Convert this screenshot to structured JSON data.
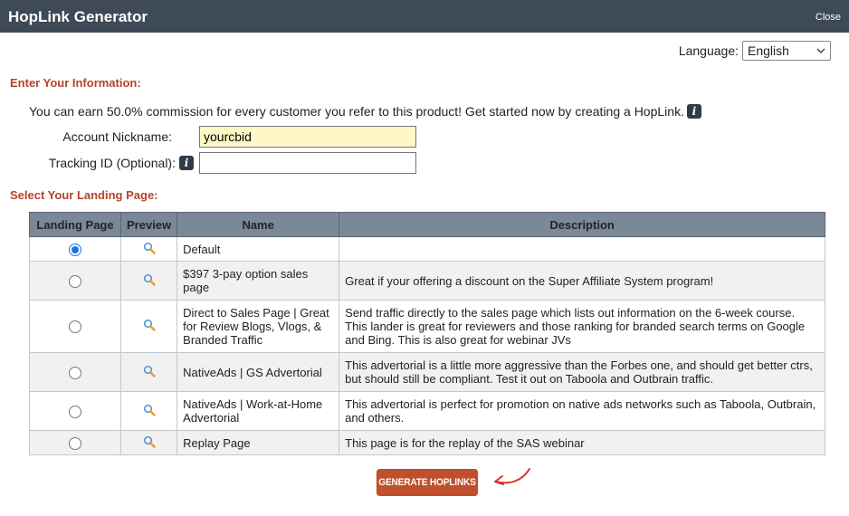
{
  "titlebar": {
    "title": "HopLink Generator",
    "close_label": "Close"
  },
  "language": {
    "label": "Language:",
    "selected": "English"
  },
  "section_info": "Enter Your Information:",
  "intro_text": "You can earn 50.0% commission for every customer you refer to this product! Get started now by creating a HopLink.",
  "form": {
    "nickname_label": "Account Nickname:",
    "nickname_value": "yourcbid",
    "tracking_label": "Tracking ID (Optional):",
    "tracking_value": ""
  },
  "section_landing": "Select Your Landing Page:",
  "table": {
    "headers": [
      "Landing Page",
      "Preview",
      "Name",
      "Description"
    ],
    "rows": [
      {
        "selected": true,
        "name": "Default",
        "description": ""
      },
      {
        "selected": false,
        "name": "$397 3-pay option sales page",
        "description": "Great if your offering a discount on the Super Affiliate System program!"
      },
      {
        "selected": false,
        "name": "Direct to Sales Page | Great for Review Blogs, Vlogs, & Branded Traffic",
        "description": "Send traffic directly to the sales page which lists out information on the 6-week course. This lander is great for reviewers and those ranking for branded search terms on Google and Bing. This is also great for webinar JVs"
      },
      {
        "selected": false,
        "name": "NativeAds | GS Advertorial",
        "description": "This advertorial is a little more aggressive than the Forbes one, and should get better ctrs, but should still be compliant. Test it out on Taboola and Outbrain traffic."
      },
      {
        "selected": false,
        "name": "NativeAds | Work-at-Home Advertorial",
        "description": "This advertorial is perfect for promotion on native ads networks such as Taboola, Outbrain, and others."
      },
      {
        "selected": false,
        "name": "Replay Page",
        "description": "This page is for the replay of the SAS webinar"
      }
    ]
  },
  "generate_label": "GENERATE HOPLINKS",
  "colors": {
    "titlebar": "#3e4a56",
    "section": "#b4432a",
    "button": "#c0502c",
    "header": "#7b8896",
    "arrow": "#d9312f"
  }
}
